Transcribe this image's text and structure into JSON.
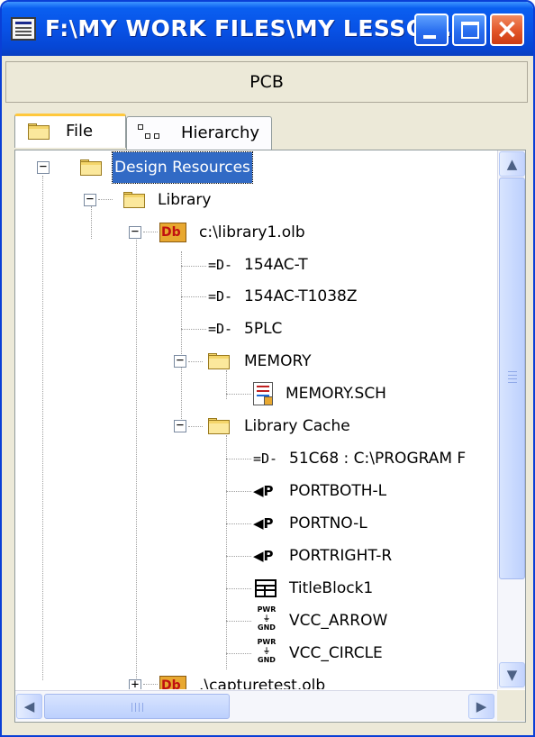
{
  "window": {
    "title": "F:\\MY WORK FILES\\MY LESSO...",
    "header": "PCB"
  },
  "tabs": [
    {
      "label": "File"
    },
    {
      "label": "Hierarchy"
    }
  ],
  "tree": {
    "root": "Design Resources",
    "library": "Library",
    "lib1": "c:\\library1.olb",
    "parts": [
      "154AC-T",
      "154AC-T1038Z",
      "5PLC"
    ],
    "memory_folder": "MEMORY",
    "memory_sch": "MEMORY.SCH",
    "cache_folder": "Library Cache",
    "cache_items": [
      "51C68 : C:\\PROGRAM F",
      "PORTBOTH-L",
      "PORTNO-L",
      "PORTRIGHT-R",
      "TitleBlock1",
      "VCC_ARROW",
      "VCC_CIRCLE"
    ],
    "lib2": ".\\capturetest.olb"
  },
  "icons": {
    "part_glyph": "=D-",
    "port_glyph": "◀P",
    "pwr_top": "PWR",
    "pwr_bottom": "GND",
    "lib_glyph": "Db",
    "scroll_up": "▲",
    "scroll_down": "▼",
    "scroll_left": "◀",
    "scroll_right": "▶"
  }
}
